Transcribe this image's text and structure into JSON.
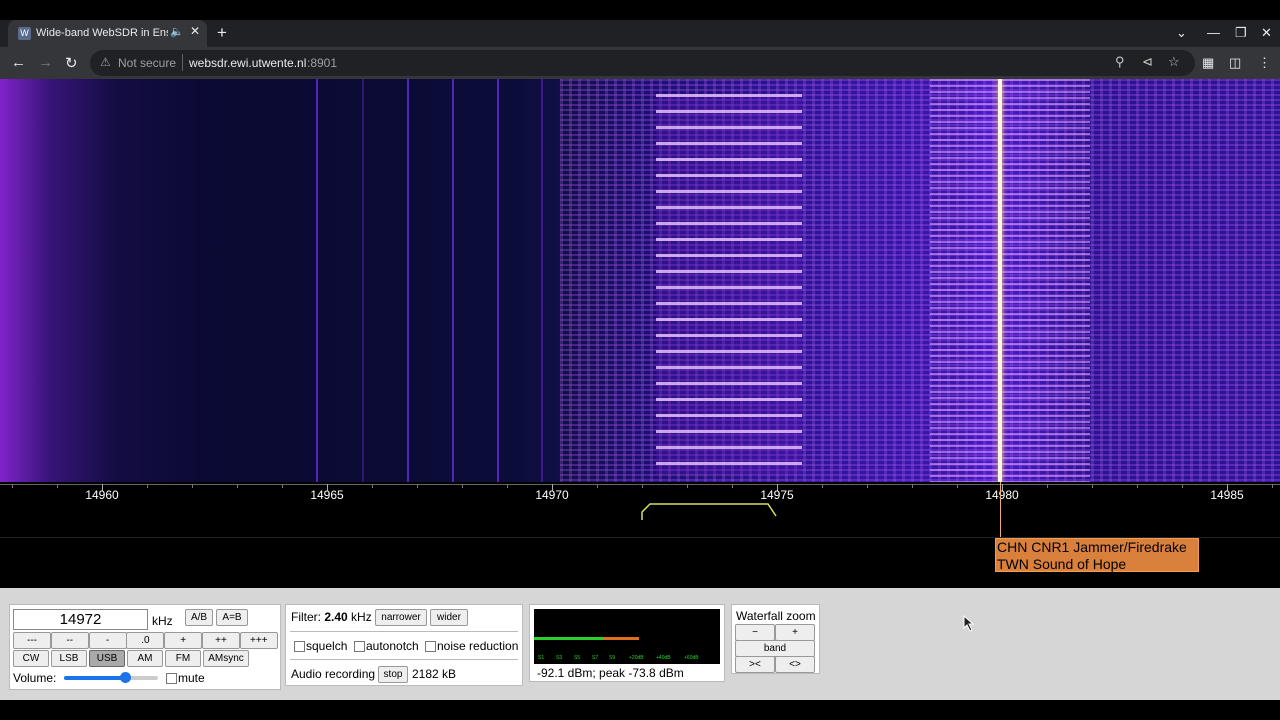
{
  "browser": {
    "tab_title": "Wide-band WebSDR in Enschede",
    "tab_audio_icon": "speaker-icon",
    "new_tab": "+",
    "security_label": "Not secure",
    "url_host": "websdr.ewi.utwente.nl",
    "url_port": ":8901"
  },
  "scale": {
    "ticks": [
      "14960",
      "14965",
      "14970",
      "14975",
      "14980",
      "14985"
    ]
  },
  "station_label": {
    "line1": "CHN CNR1 Jammer/Firedrake",
    "line2": "TWN Sound of Hope"
  },
  "freq": {
    "value": "14972",
    "unit": "kHz",
    "ab": "A/B",
    "a_eq_b": "A=B",
    "steps": [
      "---",
      "--",
      "-",
      ".0",
      "+",
      "++",
      "+++"
    ],
    "modes": [
      "CW",
      "LSB",
      "USB",
      "AM",
      "FM",
      "AMsync"
    ],
    "active_mode": "USB",
    "volume_label": "Volume:",
    "volume_level": 0.65,
    "mute_label": "mute",
    "mute_checked": false
  },
  "filter": {
    "label": "Filter:",
    "value": "2.40",
    "unit": "kHz",
    "narrower": "narrower",
    "wider": "wider",
    "squelch": "squelch",
    "autonotch": "autonotch",
    "noise_reduction": "noise reduction",
    "recording_label": "Audio recording",
    "stop": "stop",
    "recording_size": "2182 kB"
  },
  "smeter": {
    "scale": [
      "S1",
      "S3",
      "S5",
      "S7",
      "S9",
      "+20dB",
      "+40dB",
      "+60dB"
    ],
    "reading": "-92.1 dBm; peak  -73.8 dBm",
    "level_dbm": -92.1,
    "peak_dbm": -73.8,
    "level_color": "#2bd02b",
    "peak_color": "#e07020"
  },
  "zoom": {
    "label": "Waterfall zoom",
    "minus": "−",
    "plus": "+",
    "band": "band",
    "in": "><",
    "out": "<>"
  }
}
